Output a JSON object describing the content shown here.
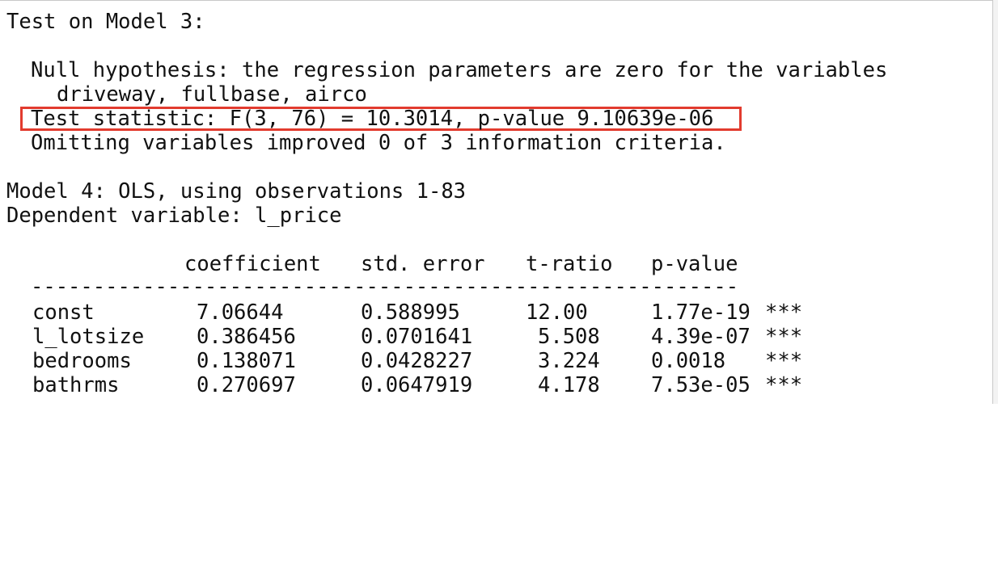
{
  "output": {
    "test_heading": "Test on Model 3:",
    "null_hypothesis_line1": "Null hypothesis: the regression parameters are zero for the variables",
    "null_hypothesis_line2": "driveway, fullbase, airco",
    "test_statistic": "Test statistic: F(3, 76) = 10.3014, p-value 9.10639e-06",
    "omitting_note": "Omitting variables improved 0 of 3 information criteria.",
    "model_heading": "Model 4: OLS, using observations 1-83",
    "dependent_variable": "Dependent variable: l_price",
    "table": {
      "headers": [
        "coefficient",
        "std. error",
        "t-ratio",
        "p-value"
      ],
      "separator": "---------------------------------------------------------",
      "rows": [
        {
          "name": "const",
          "coefficient": "7.06644",
          "std_error": "0.588995",
          "t_ratio": "12.00",
          "p_value": "1.77e-19",
          "stars": "***"
        },
        {
          "name": "l_lotsize",
          "coefficient": "0.386456",
          "std_error": "0.0701641",
          "t_ratio": "5.508",
          "p_value": "4.39e-07",
          "stars": "***"
        },
        {
          "name": "bedrooms",
          "coefficient": "0.138071",
          "std_error": "0.0428227",
          "t_ratio": "3.224",
          "p_value": "0.0018",
          "stars": "***"
        },
        {
          "name": "bathrms",
          "coefficient": "0.270697",
          "std_error": "0.0647919",
          "t_ratio": "4.178",
          "p_value": "7.53e-05",
          "stars": "***"
        }
      ]
    }
  },
  "highlight_color": "#e23b2e"
}
